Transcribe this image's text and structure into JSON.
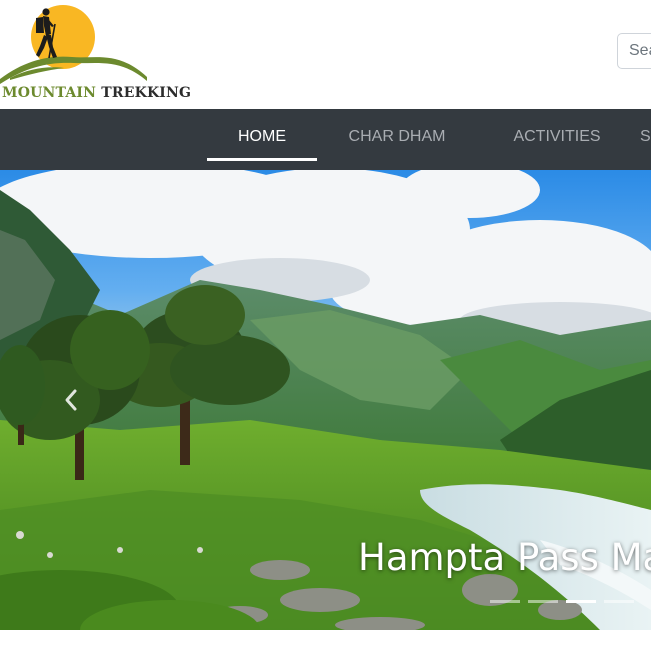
{
  "header": {
    "logo": {
      "text_word1": "MOUNTAIN",
      "text_word2": "TREKKING",
      "colors": {
        "sun": "#f9b723",
        "hill": "#6c8a2e",
        "text_green": "#6c8a2e",
        "text_dark": "#2c2c2c"
      }
    },
    "search": {
      "placeholder": "Search"
    }
  },
  "navbar": {
    "background": "#343a40",
    "items": [
      {
        "label": "HOME",
        "active": true
      },
      {
        "label": "CHAR DHAM",
        "active": false
      },
      {
        "label": "ACTIVITIES",
        "active": false
      },
      {
        "label": "S",
        "active": false
      }
    ]
  },
  "hero": {
    "caption": "Hampta Pass Ma",
    "prev_icon": "chevron-left-icon",
    "indicators": [
      {
        "active": false
      },
      {
        "active": false
      },
      {
        "active": true
      },
      {
        "active": false
      }
    ]
  }
}
